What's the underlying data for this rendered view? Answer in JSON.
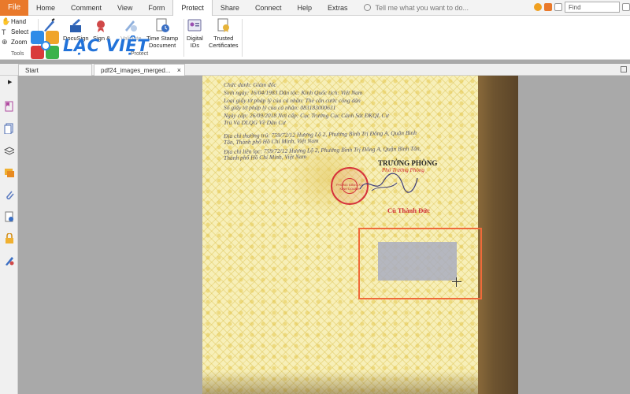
{
  "menu": {
    "file": "File",
    "tabs": [
      "Home",
      "Comment",
      "View",
      "Form",
      "Protect",
      "Share",
      "Connect",
      "Help",
      "Extras"
    ],
    "active_tab": "Protect",
    "tell_me": "Tell me what you want to do...",
    "find_placeholder": "Find"
  },
  "ribbon": {
    "tools": {
      "hand": "Hand",
      "select": "Select",
      "zoom": "Zoom",
      "group_label": "Tools"
    },
    "protect": {
      "docusign": "DocuSign",
      "sign": "Sign &",
      "validate": "Validate",
      "timestamp_1": "Time Stamp",
      "timestamp_2": "Document",
      "group_label": "Protect"
    },
    "digital_ids_1": "Digital",
    "digital_ids_2": "IDs",
    "trusted_1": "Trusted",
    "trusted_2": "Certificates"
  },
  "logo": {
    "text": "LẠC VIỆT"
  },
  "doc_tabs": [
    {
      "label": "Start"
    },
    {
      "label": "pdf24_images_merged..."
    }
  ],
  "document": {
    "lines": [
      "Chức danh:  Giám đốc",
      "Sinh ngày:      16/04/1983          Dân tộc:   Kinh                    Quốc tịch: Việt Nam",
      "Loại giấy tờ pháp lý của cá nhân:    Thẻ căn cước công dân",
      "Số giấy tờ pháp lý của cá nhân:   083183000631",
      "Ngày cấp:    26/09/2018           Nơi cấp:   Cục Trưởng Cục Cảnh Sát ĐKQL Cư",
      "                                                       Trú Và DLQG Về Dân Cư",
      "Địa chỉ thường trú: 759/72/12 Hương Lộ 2, Phường Bình Trị Đông A, Quận Bình",
      "Tân, Thành phố Hồ Chí Minh, Việt Nam",
      "Địa chỉ liên lạc: 759/72/12 Hương Lộ 2, Phường Bình Trị Đông A, Quận Bình Tân,",
      "Thành phố Hồ Chí Minh, Việt Nam"
    ],
    "title": "TRƯỞNG PHÒNG",
    "subtitle": "Phó Trưởng Phòng",
    "signer": "Cù Thành Đức",
    "seal_text": "PHÒNG ĐĂNG KÝ KINH DOANH"
  },
  "colors": {
    "file_tab": "#e9792b",
    "accent": "#2172d9",
    "selection": "#f06a3a"
  }
}
